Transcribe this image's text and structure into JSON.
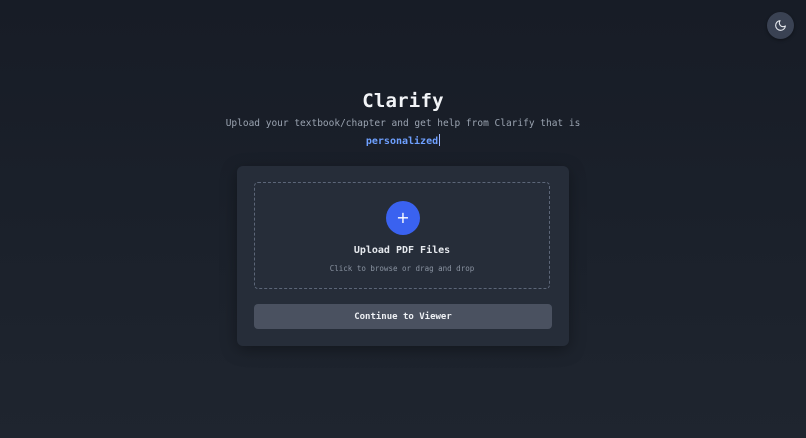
{
  "header": {
    "theme_toggle_icon": "moon-icon"
  },
  "hero": {
    "title": "Clarify",
    "subtitle": "Upload your textbook/chapter and get help from Clarify that is",
    "typed_word": "personalized"
  },
  "upload": {
    "icon": "+",
    "title": "Upload PDF Files",
    "hint": "Click to browse or drag and drop"
  },
  "actions": {
    "continue_label": "Continue to Viewer"
  },
  "colors": {
    "accent": "#3a62f0",
    "highlight": "#6ea0ff",
    "card": "#262d39",
    "button": "#4a5160"
  }
}
